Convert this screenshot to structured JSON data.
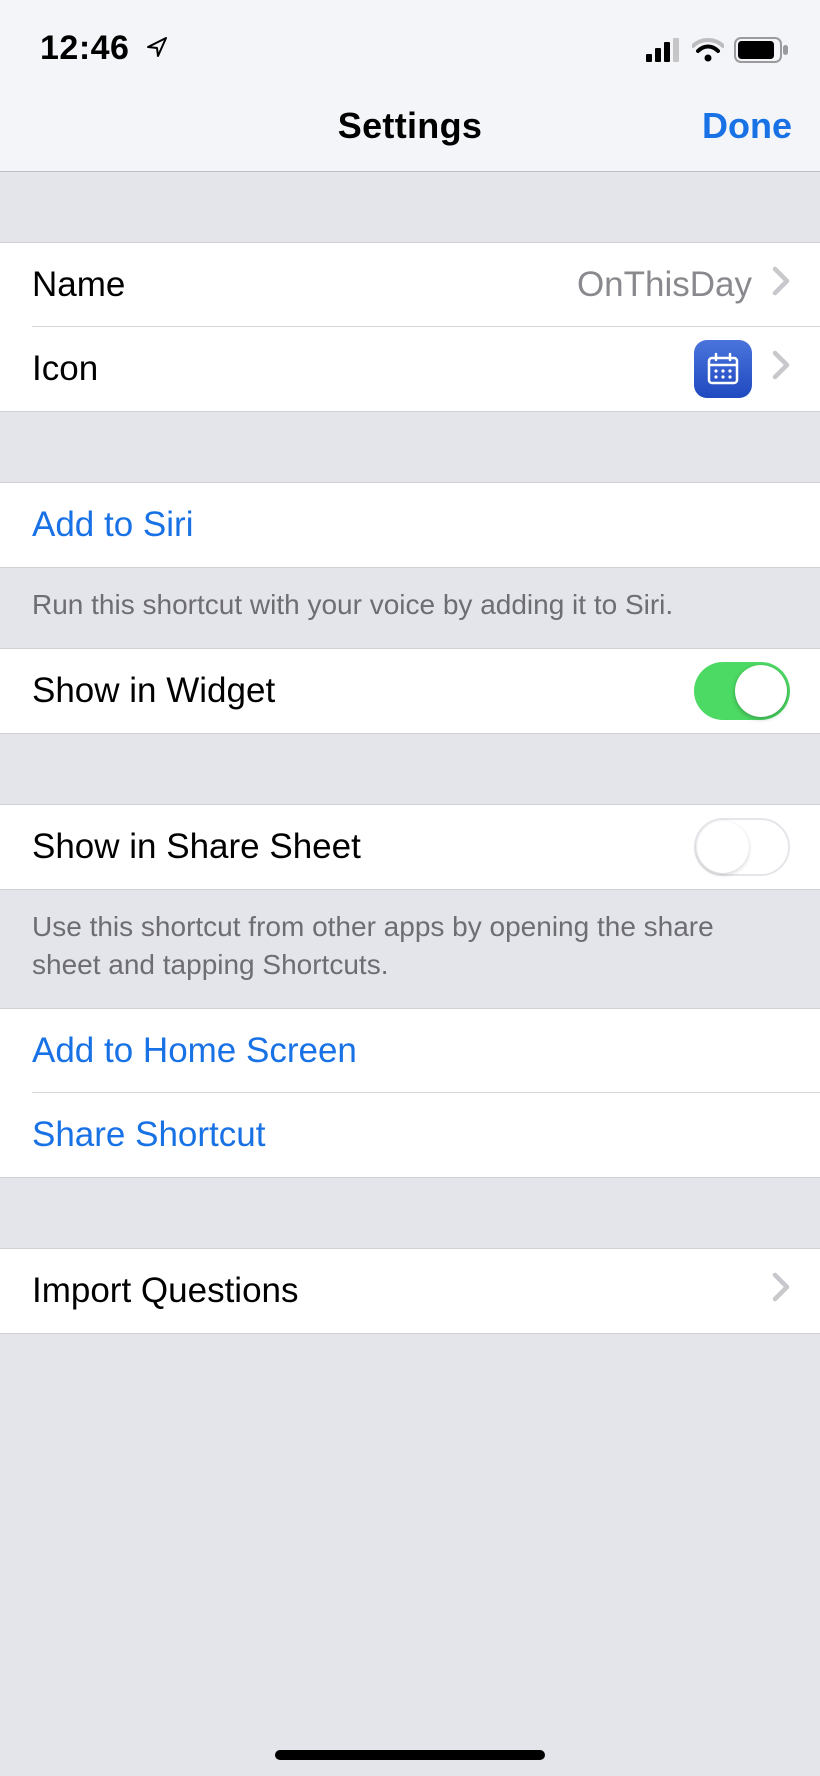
{
  "status": {
    "time": "12:46"
  },
  "nav": {
    "title": "Settings",
    "done": "Done"
  },
  "rows": {
    "name": {
      "label": "Name",
      "value": "OnThisDay"
    },
    "icon": {
      "label": "Icon"
    },
    "add_to_siri": {
      "label": "Add to Siri"
    },
    "siri_footer": "Run this shortcut with your voice by adding it to Siri.",
    "show_in_widget": {
      "label": "Show in Widget",
      "on": true
    },
    "show_in_share": {
      "label": "Show in Share Sheet",
      "on": false
    },
    "share_footer": "Use this shortcut from other apps by opening the share sheet and tapping Shortcuts.",
    "add_home": {
      "label": "Add to Home Screen"
    },
    "share_shortcut": {
      "label": "Share Shortcut"
    },
    "import_questions": {
      "label": "Import Questions"
    }
  }
}
